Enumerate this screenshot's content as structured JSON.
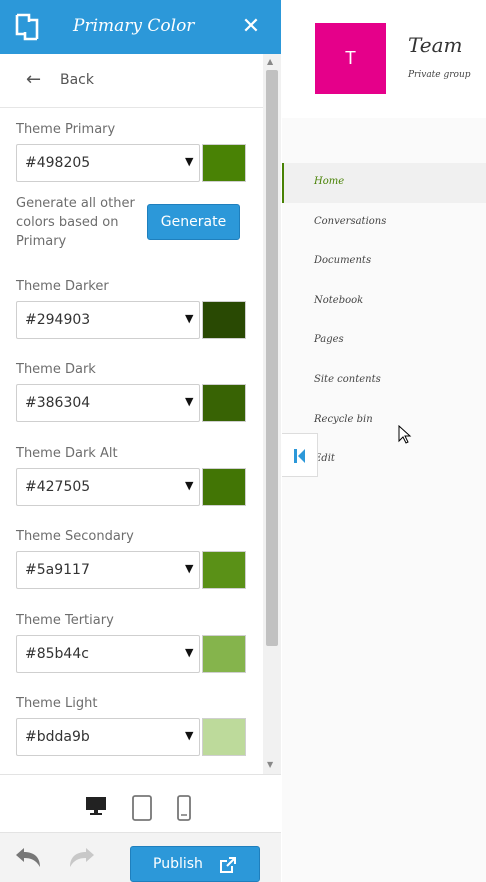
{
  "panel": {
    "title": "Primary Color",
    "back_label": "Back",
    "generate_text": "Generate all other colors based on Primary",
    "generate_label": "Generate",
    "fields": [
      {
        "label": "Theme Primary",
        "value": "#498205",
        "color": "#498205"
      },
      {
        "label": "Theme Darker",
        "value": "#294903",
        "color": "#294903"
      },
      {
        "label": "Theme Dark",
        "value": "#386304",
        "color": "#386304"
      },
      {
        "label": "Theme Dark Alt",
        "value": "#427505",
        "color": "#427505"
      },
      {
        "label": "Theme Secondary",
        "value": "#5a9117",
        "color": "#5a9117"
      },
      {
        "label": "Theme Tertiary",
        "value": "#85b44c",
        "color": "#85b44c"
      },
      {
        "label": "Theme Light",
        "value": "#bdda9b",
        "color": "#bdda9b"
      }
    ],
    "devices": [
      "desktop-icon",
      "tablet-icon",
      "phone-icon"
    ],
    "publish_label": "Publish",
    "accent": "#2c98d9"
  },
  "preview": {
    "logo_letter": "T",
    "logo_color": "#e5008a",
    "site_title": "Team",
    "site_subtitle": "Private group",
    "nav": [
      "Home",
      "Conversations",
      "Documents",
      "Notebook",
      "Pages",
      "Site contents",
      "Recycle bin",
      "Edit"
    ]
  }
}
